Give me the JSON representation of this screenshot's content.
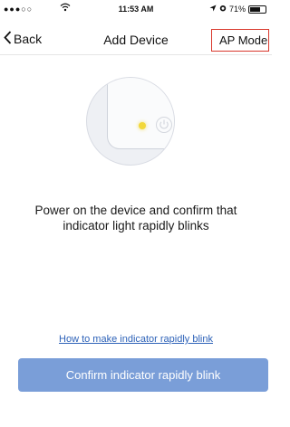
{
  "status_bar": {
    "signal": "●●●○○",
    "time": "11:53 AM",
    "battery_text": "71%",
    "battery_level": 0.71
  },
  "nav": {
    "back_label": "Back",
    "title": "Add Device",
    "ap_mode_label": "AP Mode"
  },
  "main": {
    "instruction": "Power on the device and confirm that indicator light rapidly blinks",
    "help_link": "How to make indicator rapidly blink",
    "confirm_label": "Confirm indicator rapidly blink"
  },
  "colors": {
    "accent": "#7a9ed8",
    "link": "#2d62b8",
    "ap_mode_border": "#d9372b",
    "indicator": "#f2d83a"
  },
  "icons": {
    "back": "chevron-left-icon",
    "power": "power-icon",
    "location": "location-arrow-icon",
    "alarm": "alarm-icon",
    "wifi": "wifi-icon",
    "battery": "battery-icon"
  }
}
